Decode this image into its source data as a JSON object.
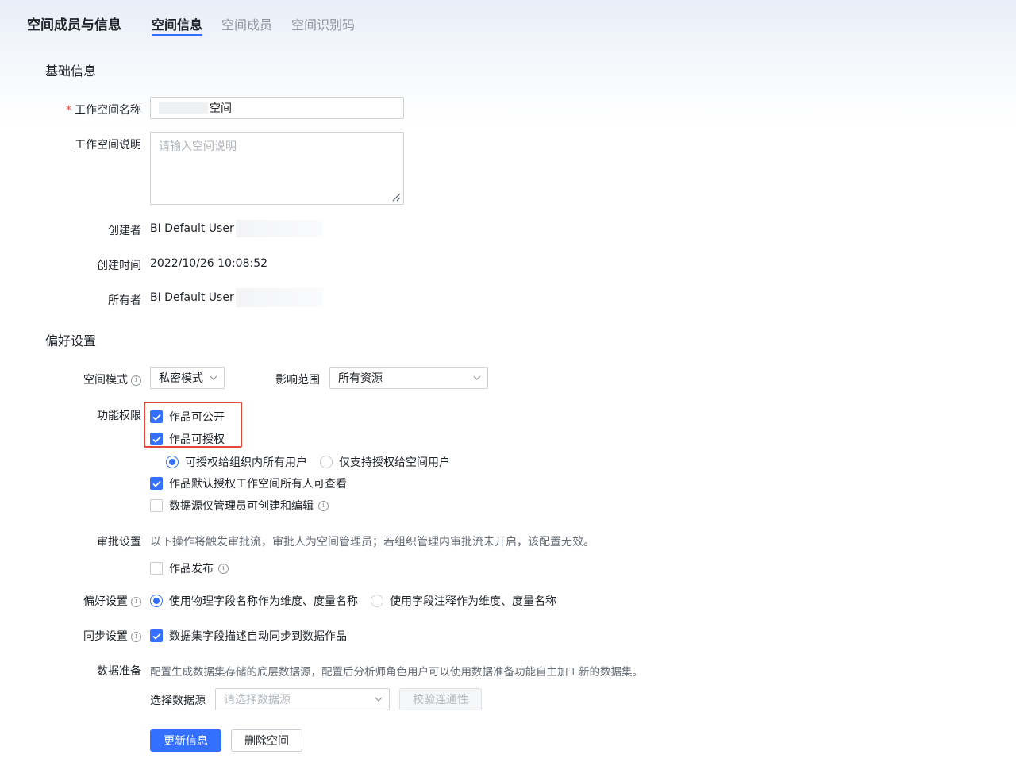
{
  "header": {
    "title": "空间成员与信息",
    "tabs": [
      {
        "label": "空间信息",
        "active": true
      },
      {
        "label": "空间成员",
        "active": false
      },
      {
        "label": "空间识别码",
        "active": false
      }
    ]
  },
  "basic": {
    "section_title": "基础信息",
    "name_required_mark": "*",
    "name_label": "工作空间名称",
    "name_value": "空间",
    "desc_label": "工作空间说明",
    "desc_placeholder": "请输入空间说明",
    "creator_label": "创建者",
    "creator_value": "BI Default User",
    "created_time_label": "创建时间",
    "created_time_value": "2022/10/26 10:08:52",
    "owner_label": "所有者",
    "owner_value": "BI Default User"
  },
  "prefs": {
    "section_title": "偏好设置",
    "space_mode_label": "空间模式",
    "space_mode_value": "私密模式",
    "scope_label": "影响范围",
    "scope_value": "所有资源",
    "perm_label": "功能权限",
    "perm_public": {
      "label": "作品可公开",
      "checked": true
    },
    "perm_grant": {
      "label": "作品可授权",
      "checked": true
    },
    "grant_radio_all": {
      "label": "可授权给组织内所有用户",
      "checked": true
    },
    "grant_radio_space": {
      "label": "仅支持授权给空间用户",
      "checked": false
    },
    "default_view": {
      "label": "作品默认授权工作空间所有人可查看",
      "checked": true
    },
    "ds_admin_only": {
      "label": "数据源仅管理员可创建和编辑",
      "checked": false
    },
    "approval_label": "审批设置",
    "approval_hint": "以下操作将触发审批流，审批人为空间管理员；若组织管理内审批流未开启，该配置无效。",
    "approval_publish": {
      "label": "作品发布",
      "checked": false
    },
    "pref_label": "偏好设置",
    "pref_radio_physical": {
      "label": "使用物理字段名称作为维度、度量名称",
      "checked": true
    },
    "pref_radio_comment": {
      "label": "使用字段注释作为维度、度量名称",
      "checked": false
    },
    "sync_label": "同步设置",
    "sync_option": {
      "label": "数据集字段描述自动同步到数据作品",
      "checked": true
    },
    "dataprep_label": "数据准备",
    "dataprep_hint": "配置生成数据集存储的底层数据源，配置后分析师角色用户可以使用数据准备功能自主加工新的数据集。",
    "ds_select_label": "选择数据源",
    "ds_select_placeholder": "请选择数据源",
    "verify_button": "校验连通性"
  },
  "actions": {
    "update_button": "更新信息",
    "delete_button": "删除空间"
  },
  "colors": {
    "accent": "#3370ff",
    "highlight_border": "#e5483b",
    "required": "#f54a45"
  }
}
